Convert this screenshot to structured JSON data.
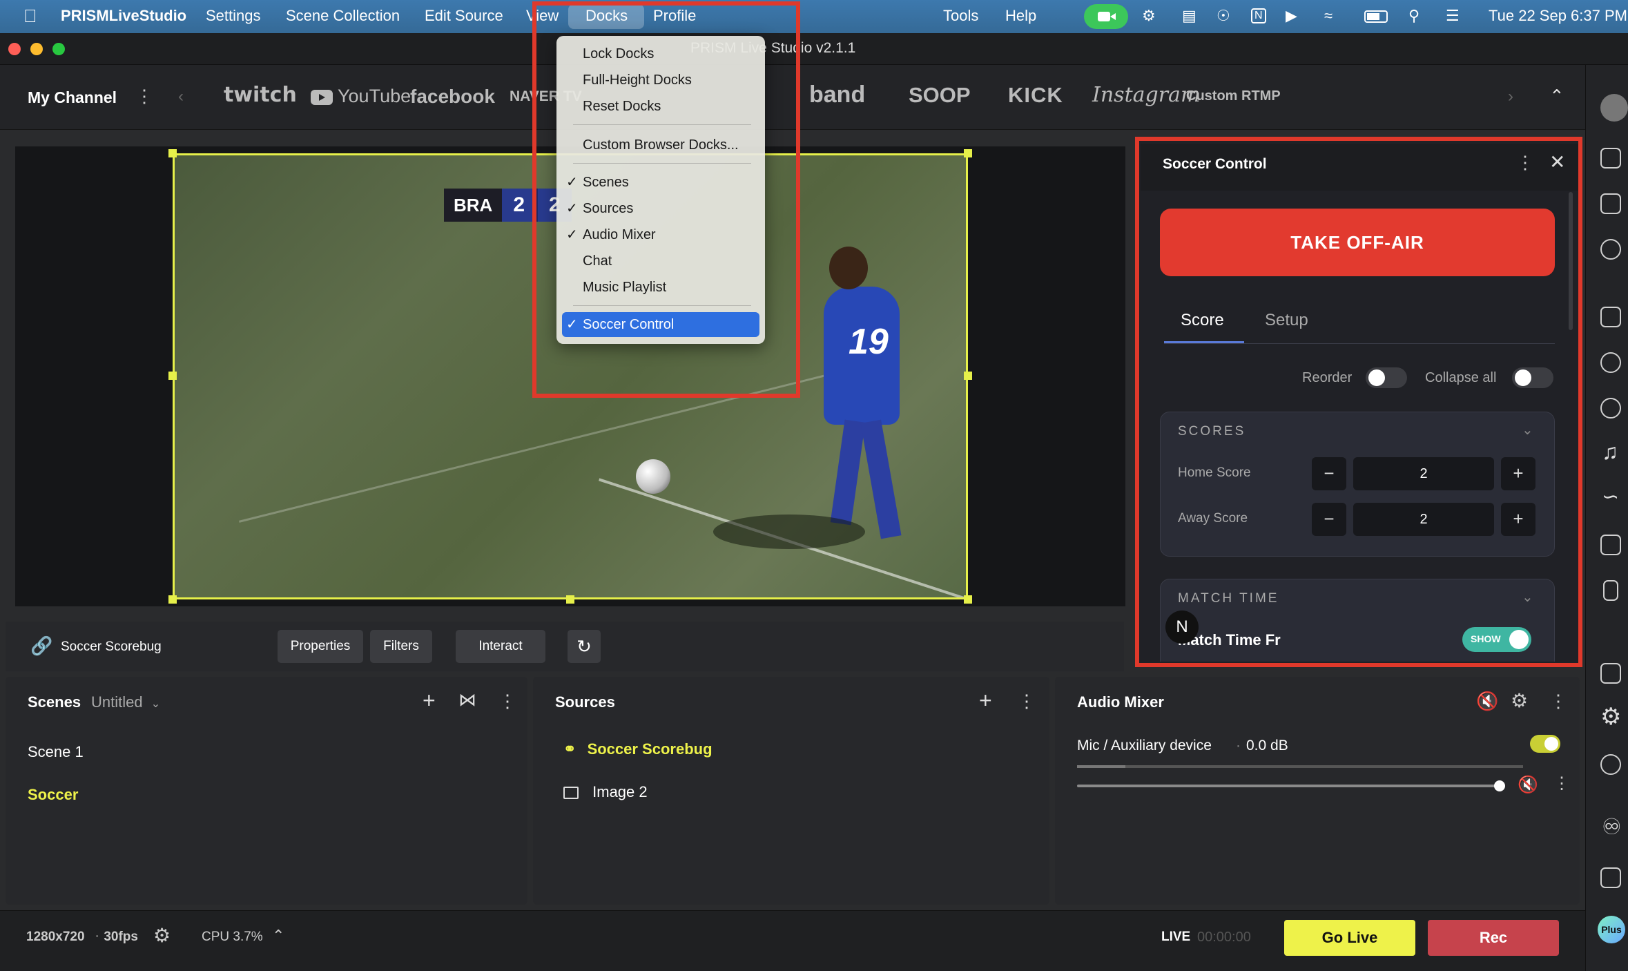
{
  "menubar": {
    "app_name": "PRISMLiveStudio",
    "items": [
      "Settings",
      "Scene Collection",
      "Edit Source",
      "View",
      "Docks",
      "Profile",
      "Tools",
      "Help"
    ],
    "clock": "Tue 22 Sep  6:37 PM"
  },
  "window": {
    "title": "PRISM Live Studio v2.1.1"
  },
  "channel": {
    "label": "My Channel",
    "platforms": [
      "twitch",
      "YouTube",
      "facebook",
      "NAVER TV",
      "band",
      "SOOP",
      "KICK",
      "Instagram",
      "Custom RTMP"
    ]
  },
  "docks_menu": {
    "items": [
      {
        "label": "Lock Docks",
        "checked": false
      },
      {
        "label": "Full-Height Docks",
        "checked": false
      },
      {
        "label": "Reset Docks",
        "checked": false
      },
      {
        "label": "Custom Browser Docks...",
        "checked": false
      },
      {
        "label": "Scenes",
        "checked": true
      },
      {
        "label": "Sources",
        "checked": true
      },
      {
        "label": "Audio Mixer",
        "checked": true
      },
      {
        "label": "Chat",
        "checked": false
      },
      {
        "label": "Music Playlist",
        "checked": false
      },
      {
        "label": "Soccer Control",
        "checked": true,
        "highlighted": true
      }
    ],
    "check_glyph": "✓"
  },
  "preview": {
    "scorebug": {
      "team": "BRA",
      "home": "2",
      "away": "2"
    },
    "jersey_number": "19"
  },
  "source_toolbar": {
    "source_name": "Soccer Scorebug",
    "properties": "Properties",
    "filters": "Filters",
    "interact": "Interact"
  },
  "scenes": {
    "title": "Scenes",
    "collection": "Untitled",
    "items": [
      {
        "label": "Scene 1",
        "active": false
      },
      {
        "label": "Soccer",
        "active": true
      }
    ]
  },
  "sources": {
    "title": "Sources",
    "items": [
      {
        "label": "Soccer Scorebug",
        "active": true
      },
      {
        "label": "Image 2",
        "active": false
      }
    ]
  },
  "audio_mixer": {
    "title": "Audio Mixer",
    "device": "Mic / Auxiliary device",
    "level": "0.0 dB"
  },
  "footer": {
    "resolution": "1280x720",
    "fps": "30fps",
    "cpu": "CPU 3.7%",
    "live_label": "LIVE",
    "live_time": "00:00:00",
    "go_live": "Go Live",
    "rec": "Rec"
  },
  "soccer_control": {
    "title": "Soccer Control",
    "take_off_air": "TAKE OFF-AIR",
    "tabs": [
      "Score",
      "Setup"
    ],
    "reorder": "Reorder",
    "collapse_all": "Collapse all",
    "scores": {
      "header": "SCORES",
      "home_label": "Home Score",
      "home_value": "2",
      "away_label": "Away Score",
      "away_value": "2"
    },
    "match_time": {
      "header": "MATCH TIME",
      "row_label": "Match Time Fr",
      "toggle_label": "SHOW"
    }
  },
  "colors": {
    "accent_yellow": "#e6f04a",
    "red": "#e0392b",
    "go_live": "#eef24a",
    "rec": "#c6434c",
    "take_off_air": "#e23a2f"
  },
  "plus_badge": "Plus"
}
